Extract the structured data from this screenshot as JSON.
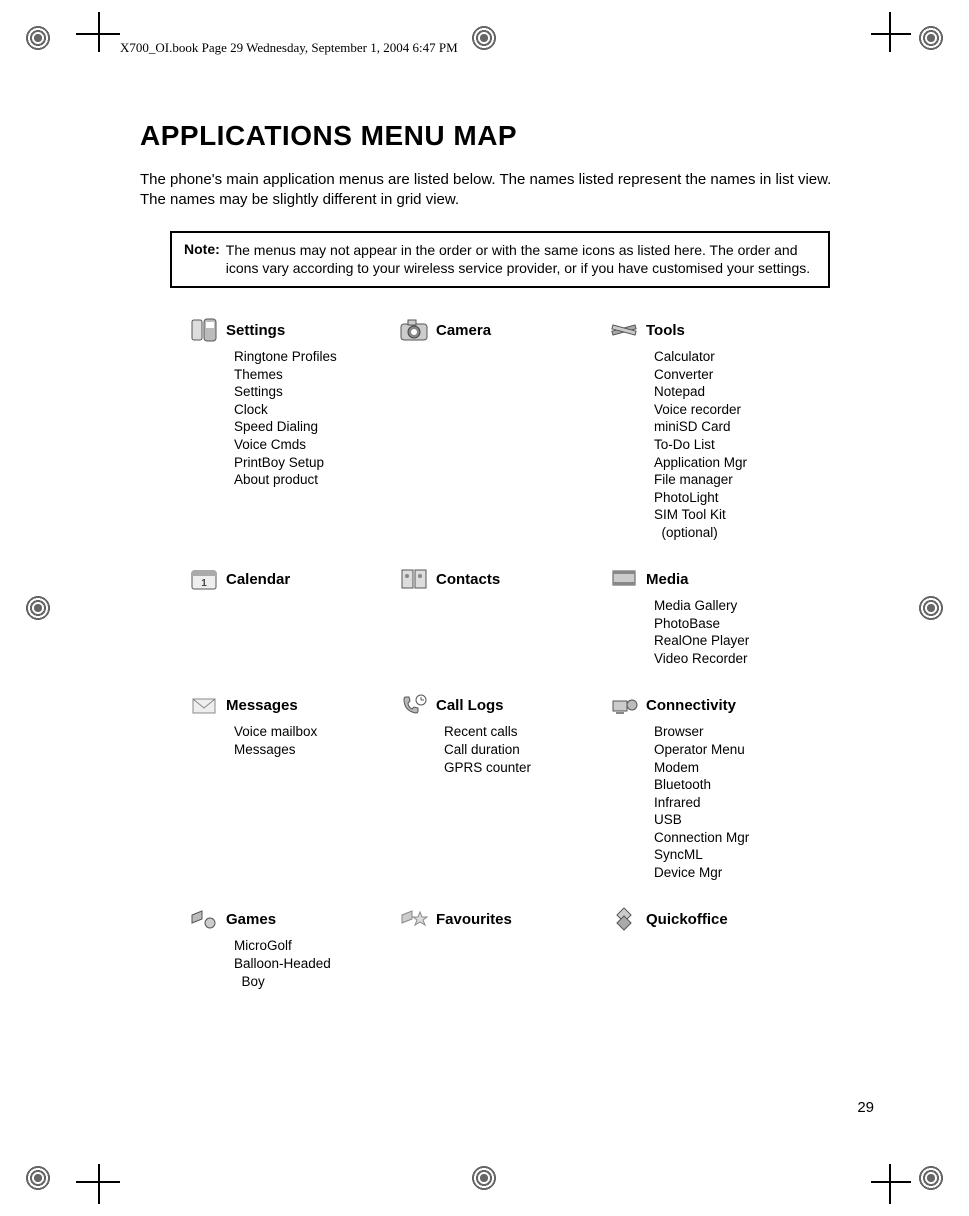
{
  "header_line": "X700_OI.book  Page 29  Wednesday, September 1, 2004  6:47 PM",
  "title": "APPLICATIONS MENU MAP",
  "intro": "The phone's main application menus are listed below. The names listed represent the names in list view. The names may be slightly different in grid view.",
  "note_label": "Note:",
  "note_body": "The menus may not appear in the order or with the same icons as listed here. The order and icons vary according to your wireless service provider, or if you have customised your settings.",
  "columns": [
    [
      {
        "title": "Settings",
        "icon": "settings-icon",
        "items": [
          "Ringtone Profiles",
          "Themes",
          "Settings",
          "Clock",
          "Speed Dialing",
          "Voice Cmds",
          "PrintBoy Setup",
          "About product"
        ]
      },
      {
        "title": "Calendar",
        "icon": "calendar-icon",
        "items": []
      },
      {
        "title": "Messages",
        "icon": "messages-icon",
        "items": [
          "Voice mailbox",
          "Messages"
        ]
      },
      {
        "title": "Games",
        "icon": "games-icon",
        "items": [
          "MicroGolf",
          "Balloon-Headed\n  Boy"
        ]
      }
    ],
    [
      {
        "title": "Camera",
        "icon": "camera-icon",
        "items": []
      },
      {
        "title": "Contacts",
        "icon": "contacts-icon",
        "items": []
      },
      {
        "title": "Call Logs",
        "icon": "call-logs-icon",
        "items": [
          "Recent calls",
          "Call duration",
          "GPRS counter"
        ]
      },
      {
        "title": "Favourites",
        "icon": "favourites-icon",
        "items": []
      }
    ],
    [
      {
        "title": "Tools",
        "icon": "tools-icon",
        "items": [
          "Calculator",
          "Converter",
          "Notepad",
          "Voice recorder",
          "miniSD Card",
          "To-Do List",
          "Application Mgr",
          "File manager",
          "PhotoLight",
          "SIM Tool Kit\n  (optional)"
        ]
      },
      {
        "title": "Media",
        "icon": "media-icon",
        "items": [
          "Media Gallery",
          "PhotoBase",
          "RealOne Player",
          "Video Recorder"
        ]
      },
      {
        "title": "Connectivity",
        "icon": "connectivity-icon",
        "items": [
          "Browser",
          "Operator Menu",
          "Modem",
          "Bluetooth",
          "Infrared",
          "USB",
          "Connection Mgr",
          "SyncML",
          "Device Mgr"
        ]
      },
      {
        "title": "Quickoffice",
        "icon": "quickoffice-icon",
        "items": []
      }
    ]
  ],
  "page_number": "29"
}
